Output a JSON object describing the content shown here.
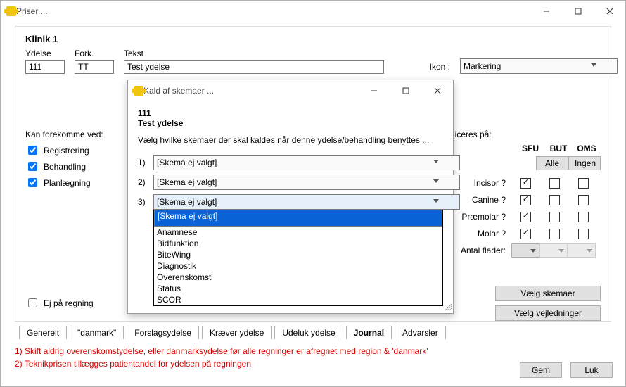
{
  "window": {
    "title": "Priser ..."
  },
  "header": {
    "clinic": "Klinik 1",
    "ydelse_label": "Ydelse",
    "ydelse_value": "111",
    "fork_label": "Fork.",
    "fork_value": "TT",
    "tekst_label": "Tekst",
    "tekst_value": "Test ydelse",
    "ikon_label": "Ikon :",
    "ikon_value": "Markering"
  },
  "forekom": {
    "label": "Kan forekomme ved:",
    "items": [
      "Registrering",
      "Behandling",
      "Planlægning"
    ]
  },
  "appl_label": "liceres på:",
  "schema": {
    "cols": [
      "SFU",
      "BUT",
      "OMS"
    ],
    "btn_all": "Alle",
    "btn_none": "Ingen",
    "rows": [
      "Incisor ?",
      "Canine ?",
      "Præmolar ?",
      "Molar ?"
    ],
    "antal_label": "Antal flader:",
    "vaelg_skemaer": "Vælg skemaer",
    "vaelg_vejl": "Vælg vejledninger"
  },
  "ej_regning": "Ej på regning",
  "tabs": [
    "Generelt",
    "\"danmark\"",
    "Forslagsydelse",
    "Kræver ydelse",
    "Udeluk ydelse",
    "Journal",
    "Advarsler"
  ],
  "notes": {
    "l1": "1) Skift aldrig overenskomstydelse, eller danmarksydelse før alle regninger er afregnet med region & 'danmark'",
    "l2": "2) Teknikprisen tillægges patientandel for ydelsen på regningen"
  },
  "footer": {
    "gem": "Gem",
    "luk": "Luk"
  },
  "modal": {
    "title": "Kald af skemaer ...",
    "code": "111",
    "service": "Test ydelse",
    "desc": "Vælg hvilke skemaer der skal kaldes når denne ydelse/behandling benyttes ...",
    "placeholder": "[Skema ej valgt]",
    "rows": [
      "1)",
      "2)",
      "3)"
    ],
    "options": [
      "[Skema ej valgt]",
      "Anamnese",
      "Bidfunktion",
      "BiteWing",
      "Diagnostik",
      "Overenskomst",
      "Status",
      "SCOR"
    ]
  }
}
